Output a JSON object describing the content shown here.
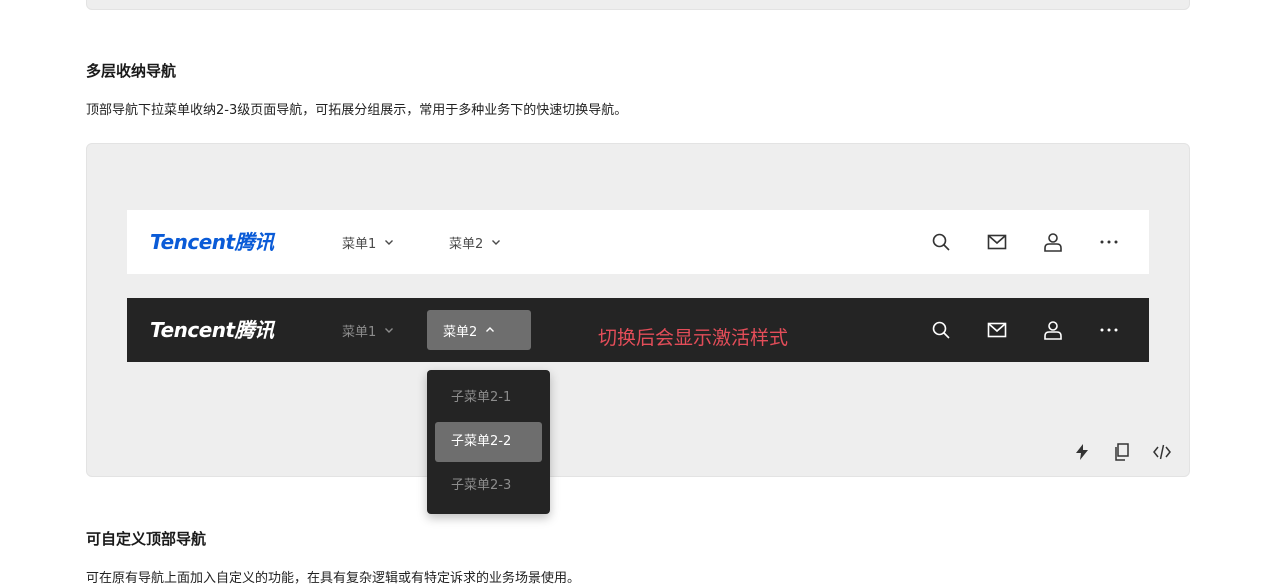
{
  "sections": {
    "multilevel": {
      "title": "多层收纳导航",
      "desc": "顶部导航下拉菜单收纳2-3级页面导航，可拓展分组展示，常用于多种业务下的快速切换导航。"
    },
    "custom": {
      "title": "可自定义顶部导航",
      "desc": "可在原有导航上面加入自定义的功能，在具有复杂逻辑或有特定诉求的业务场景使用。"
    }
  },
  "light_nav": {
    "logo": "Tencent腾讯",
    "menus": [
      {
        "label": "菜单1"
      },
      {
        "label": "菜单2"
      }
    ]
  },
  "dark_nav": {
    "logo": "Tencent腾讯",
    "menus": [
      {
        "label": "菜单1"
      },
      {
        "label": "菜单2"
      }
    ],
    "annotation": "切换后会显示激活样式",
    "dropdown": [
      {
        "label": "子菜单2-1"
      },
      {
        "label": "子菜单2-2"
      },
      {
        "label": "子菜单2-3"
      }
    ]
  },
  "icons": [
    "search-icon",
    "mail-icon",
    "user-icon",
    "more-icon"
  ],
  "toolbar_icons": [
    "lightning-icon",
    "copy-icon",
    "code-icon"
  ],
  "colors": {
    "brand": "#0a5bd7",
    "annotation": "#e34d59",
    "dark_bg": "#242424",
    "active_bg": "#6e6e6e"
  }
}
